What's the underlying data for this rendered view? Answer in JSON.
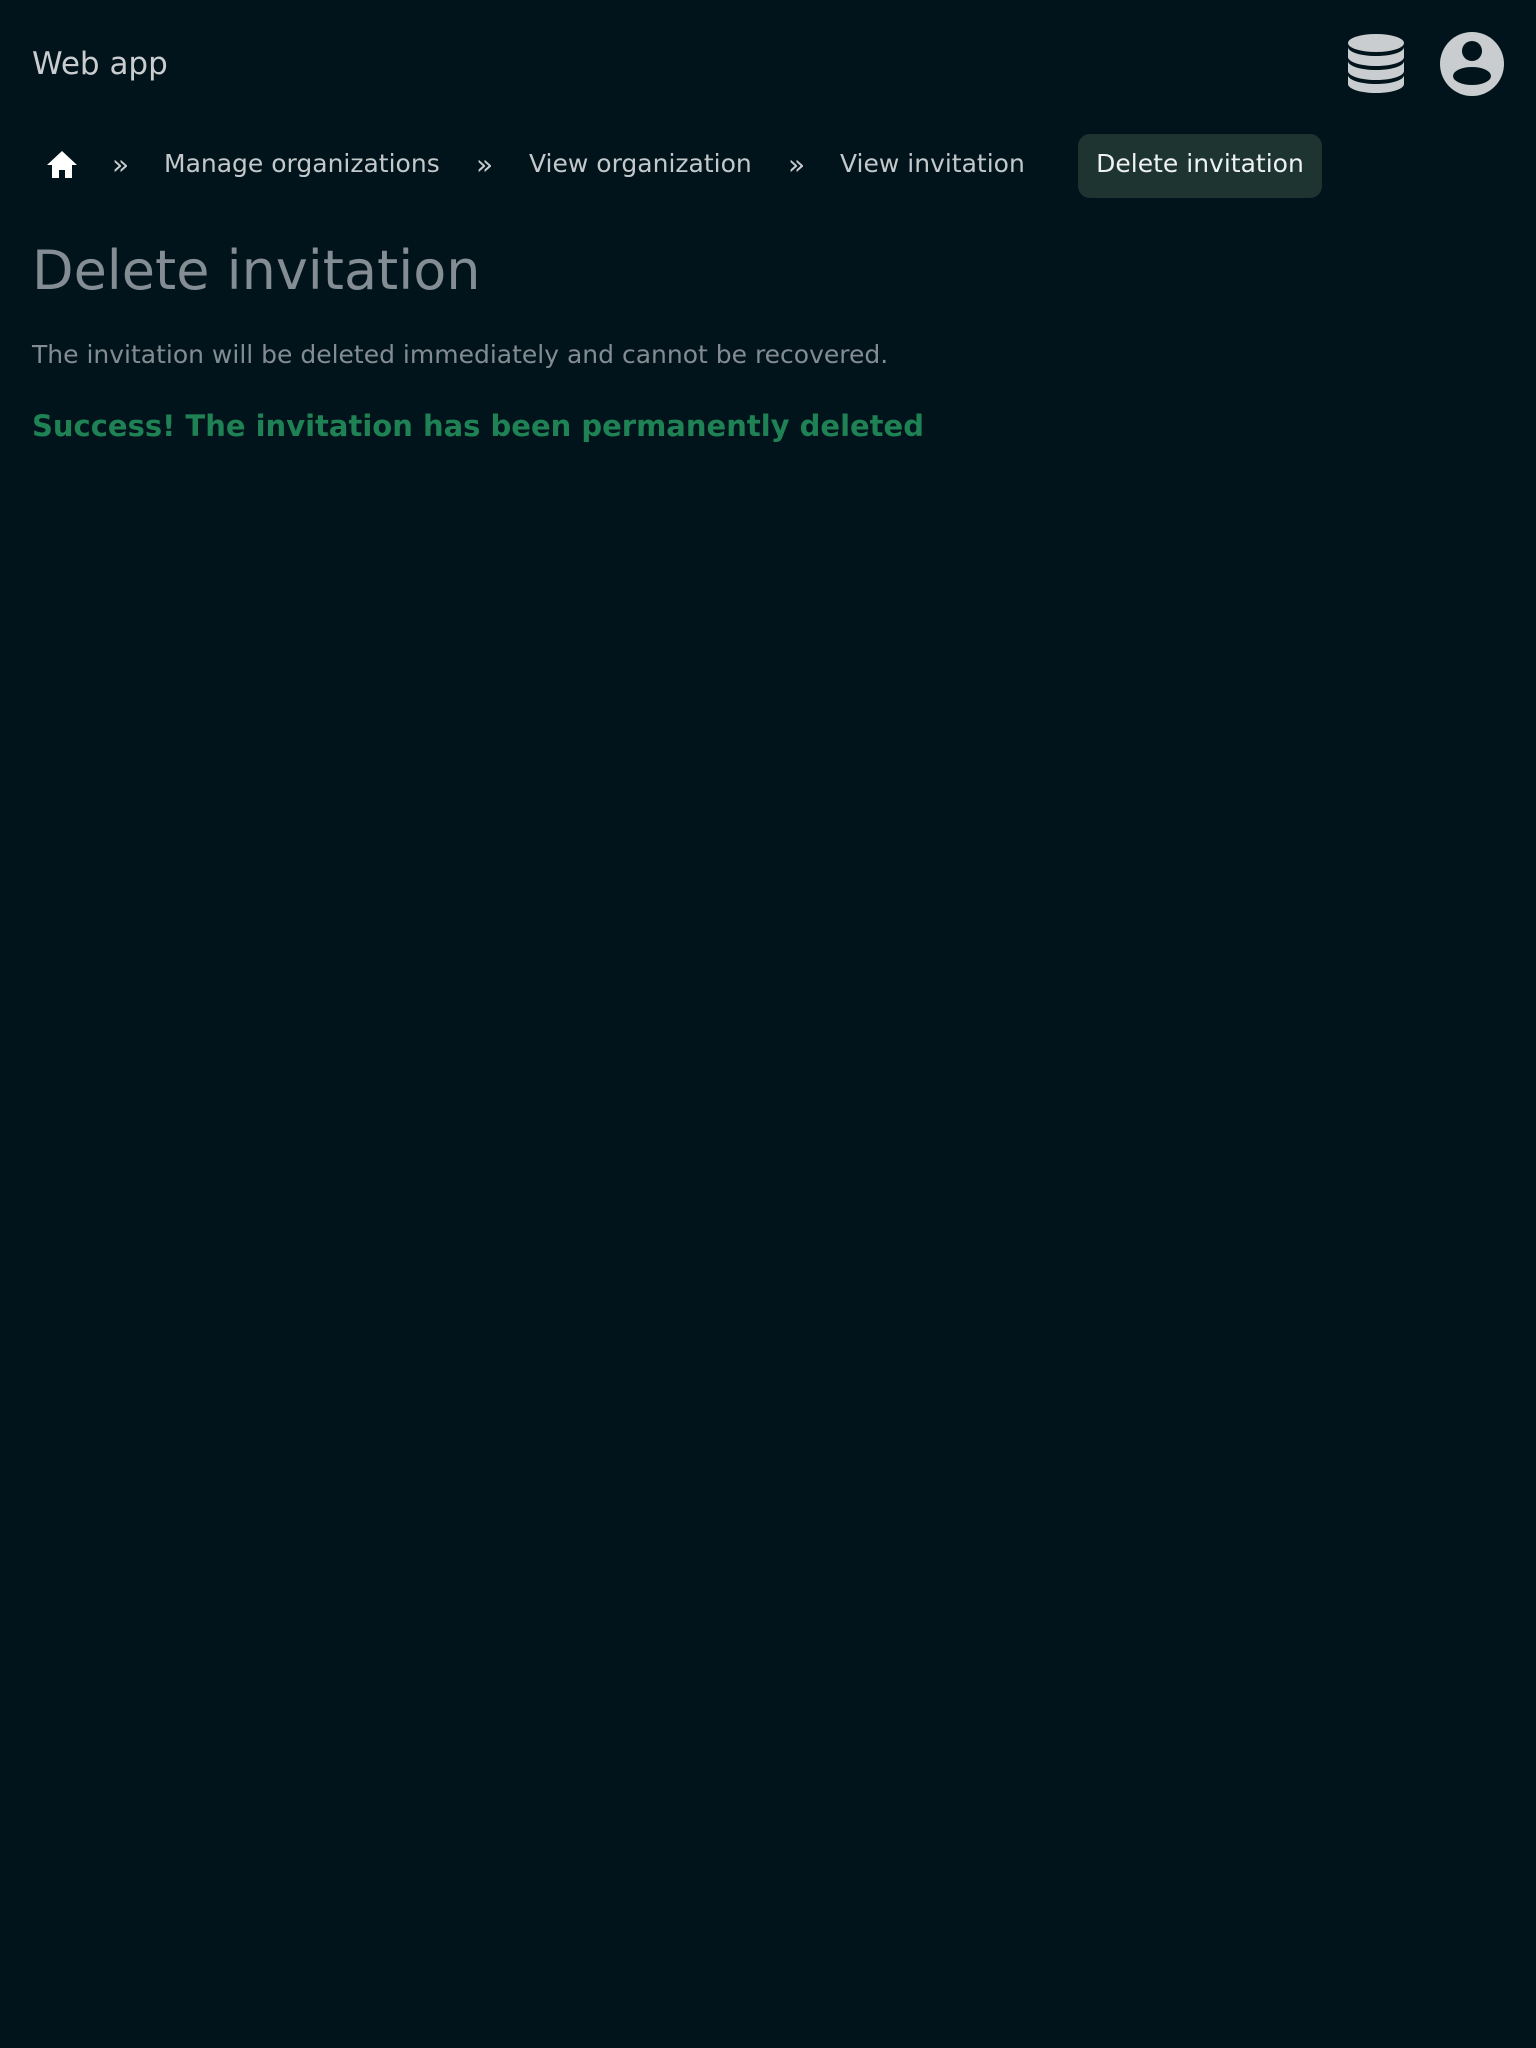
{
  "header": {
    "app_title": "Web app",
    "icons": [
      "database-icon",
      "user-account-icon"
    ]
  },
  "breadcrumb": {
    "home_icon": "home-icon",
    "separator": "»",
    "items": [
      {
        "label": "Manage organizations"
      },
      {
        "label": "View organization"
      },
      {
        "label": "View invitation"
      }
    ],
    "current": "Delete invitation"
  },
  "main": {
    "title": "Delete invitation",
    "description": "The invitation will be deleted immediately and cannot be recovered.",
    "status_message": "Success! The invitation has been permanently deleted"
  },
  "colors": {
    "background": "#01141b",
    "active_crumb_bg": "#1e3431",
    "success": "#1f8255",
    "muted_text": "#838d93"
  }
}
